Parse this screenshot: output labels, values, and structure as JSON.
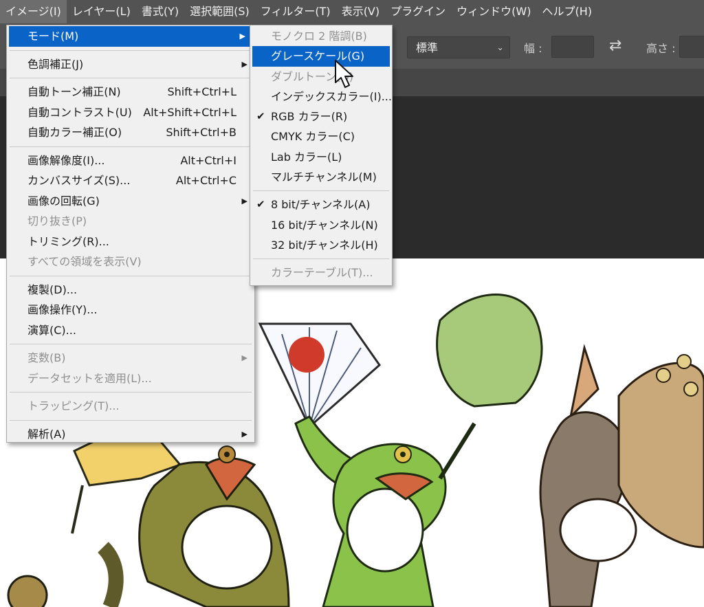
{
  "menubar": {
    "items": [
      {
        "label": "イメージ(I)",
        "active": true
      },
      {
        "label": "レイヤー(L)"
      },
      {
        "label": "書式(Y)"
      },
      {
        "label": "選択範囲(S)"
      },
      {
        "label": "フィルター(T)"
      },
      {
        "label": "表示(V)"
      },
      {
        "label": "プラグイン"
      },
      {
        "label": "ウィンドウ(W)"
      },
      {
        "label": "ヘルプ(H)"
      }
    ]
  },
  "options": {
    "style_value": "標準",
    "width_label": "幅 :",
    "height_label": "高さ :"
  },
  "image_menu": {
    "mode": "モード(M)",
    "adjustments": "色調補正(J)",
    "auto_tone": "自動トーン補正(N)",
    "auto_tone_sc": "Shift+Ctrl+L",
    "auto_contrast": "自動コントラスト(U)",
    "auto_contrast_sc": "Alt+Shift+Ctrl+L",
    "auto_color": "自動カラー補正(O)",
    "auto_color_sc": "Shift+Ctrl+B",
    "image_size": "画像解像度(I)...",
    "image_size_sc": "Alt+Ctrl+I",
    "canvas_size": "カンバスサイズ(S)...",
    "canvas_size_sc": "Alt+Ctrl+C",
    "rotation": "画像の回転(G)",
    "crop": "切り抜き(P)",
    "trim": "トリミング(R)...",
    "reveal_all": "すべての領域を表示(V)",
    "duplicate": "複製(D)...",
    "apply_image": "画像操作(Y)...",
    "calculations": "演算(C)...",
    "variables": "変数(B)",
    "apply_dataset": "データセットを適用(L)...",
    "trap": "トラッピング(T)...",
    "analysis": "解析(A)"
  },
  "mode_menu": {
    "bitmap": "モノクロ 2 階調(B)",
    "grayscale": "グレースケール(G)",
    "duotone": "ダブルトーン(D)",
    "indexed": "インデックスカラー(I)...",
    "rgb": "RGB カラー(R)",
    "cmyk": "CMYK カラー(C)",
    "lab": "Lab カラー(L)",
    "multichannel": "マルチチャンネル(M)",
    "bit8": "8 bit/チャンネル(A)",
    "bit16": "16 bit/チャンネル(N)",
    "bit32": "32 bit/チャンネル(H)",
    "color_table": "カラーテーブル(T)..."
  },
  "icons": {
    "check": "✔",
    "arrow": "▶",
    "chevron": "⌄",
    "swap": "⇄"
  },
  "colors": {
    "menubar_bg": "#535353",
    "highlight": "#0a64c8",
    "menu_bg": "#f0f0f0",
    "disabled_text": "#8f8f8f"
  }
}
